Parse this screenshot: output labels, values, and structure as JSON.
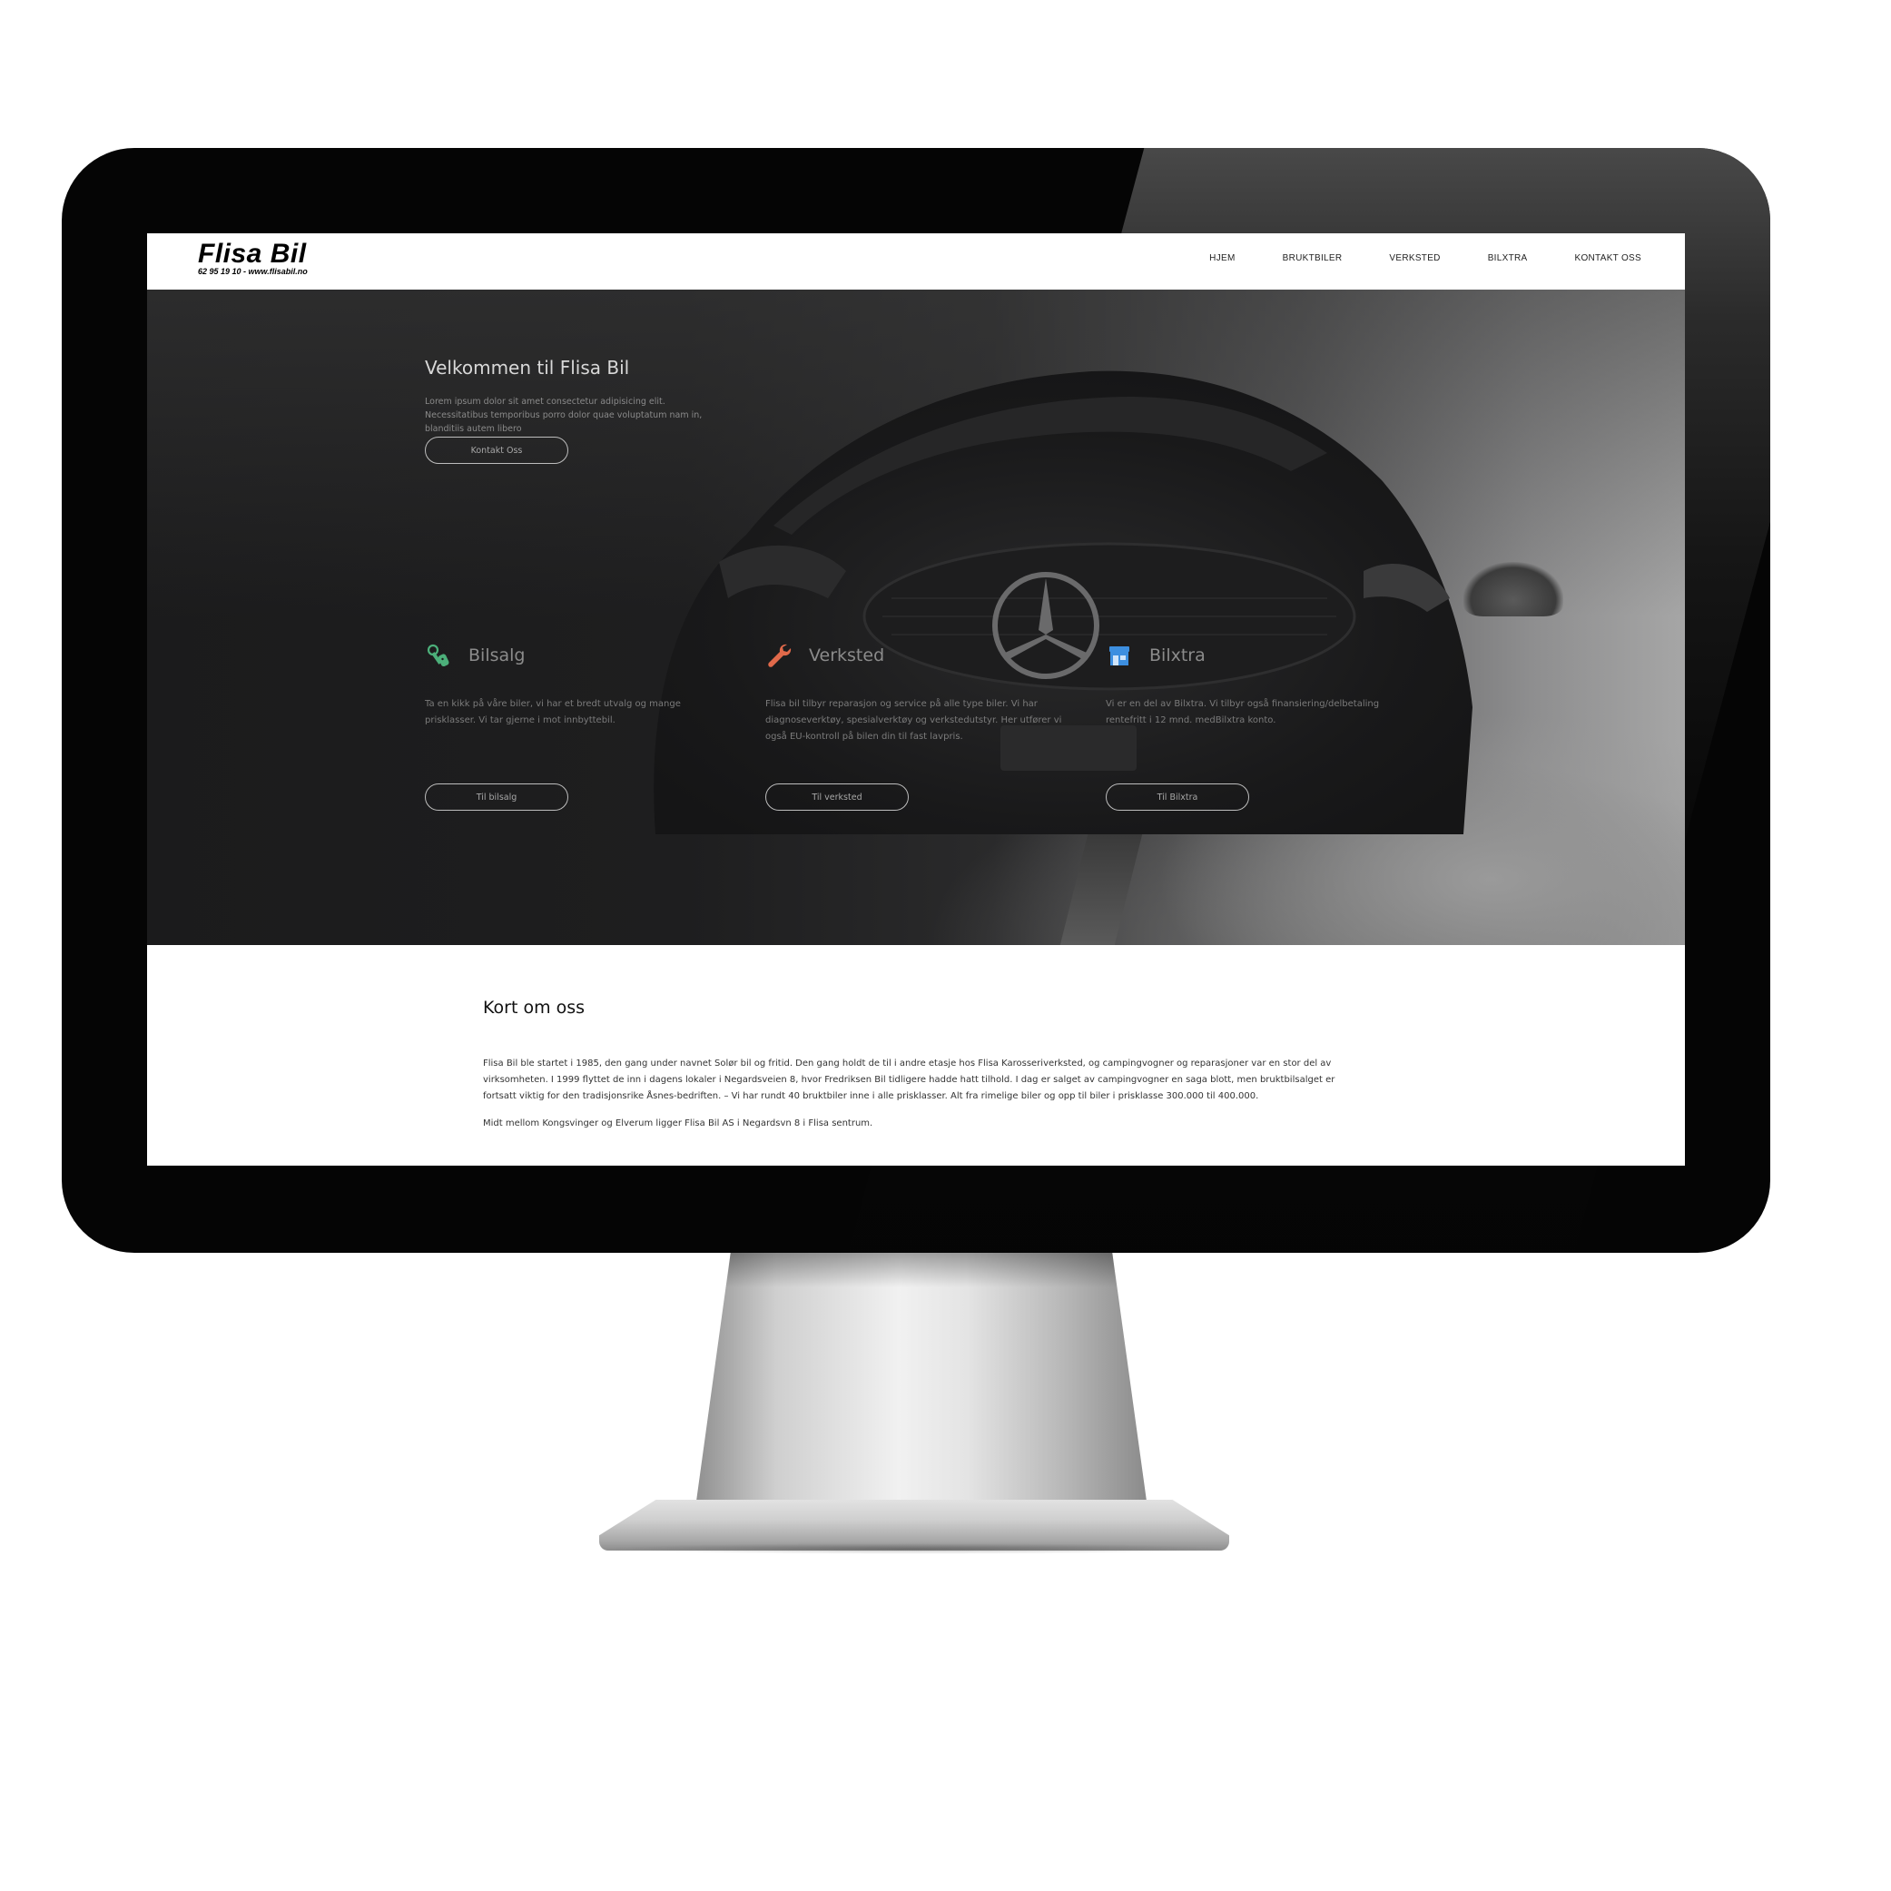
{
  "header": {
    "logo_name": "Flisa Bil",
    "logo_sub": "62 95 19 10 - www.flisabil.no",
    "nav": [
      {
        "label": "HJEM"
      },
      {
        "label": "BRUKTBILER"
      },
      {
        "label": "VERKSTED"
      },
      {
        "label": "BILXTRA"
      },
      {
        "label": "KONTAKT OSS"
      }
    ]
  },
  "hero": {
    "title": "Velkommen til Flisa Bil",
    "lead": "Lorem ipsum dolor sit amet consectetur adipisicing elit. Necessitatibus temporibus porro dolor quae voluptatum nam in, blanditiis autem libero",
    "cta_label": "Kontakt Oss"
  },
  "features": [
    {
      "title": "Bilsalg",
      "icon": "car-keys-icon",
      "icon_color": "#4caf7a",
      "text": "Ta en kikk på våre biler, vi har et bredt utvalg og mange prisklasser. Vi tar gjerne i mot innbyttebil.",
      "button_label": "Til bilsalg"
    },
    {
      "title": "Verksted",
      "icon": "wrench-icon",
      "icon_color": "#e0694a",
      "text": "Flisa bil tilbyr reparasjon og service på alle type biler. Vi har diagnoseverktøy, spesialverktøy og verkstedutstyr. Her utfører vi også EU-kontroll på bilen din til fast lavpris.",
      "button_label": "Til verksted"
    },
    {
      "title": "Bilxtra",
      "icon": "store-icon",
      "icon_color": "#3d8fe0",
      "text": "Vi er en del av Bilxtra. Vi tilbyr også finansiering/delbetaling rentefritt i 12 mnd. medBilxtra konto.",
      "button_label": "Til Bilxtra"
    }
  ],
  "about": {
    "title": "Kort om oss",
    "paragraph1": "Flisa Bil ble startet i 1985, den gang under navnet Solør bil og fritid. Den gang holdt de til i andre etasje hos Flisa Karosseriverksted, og campingvogner og reparasjoner var en stor del av virksomheten. I 1999 flyttet de inn i dagens lokaler i Negardsveien 8, hvor Fredriksen Bil tidligere hadde hatt tilhold. I dag er salget av campingvogner en saga blott, men bruktbilsalget er fortsatt viktig for den tradisjonsrike Åsnes-bedriften. – Vi har rundt 40 bruktbiler inne i alle prisklasser. Alt fra rimelige biler og opp til biler i prisklasse 300.000 til 400.000.",
    "paragraph2": "Midt mellom Kongsvinger og Elverum ligger Flisa Bil AS i Negardsvn 8 i Flisa sentrum."
  }
}
